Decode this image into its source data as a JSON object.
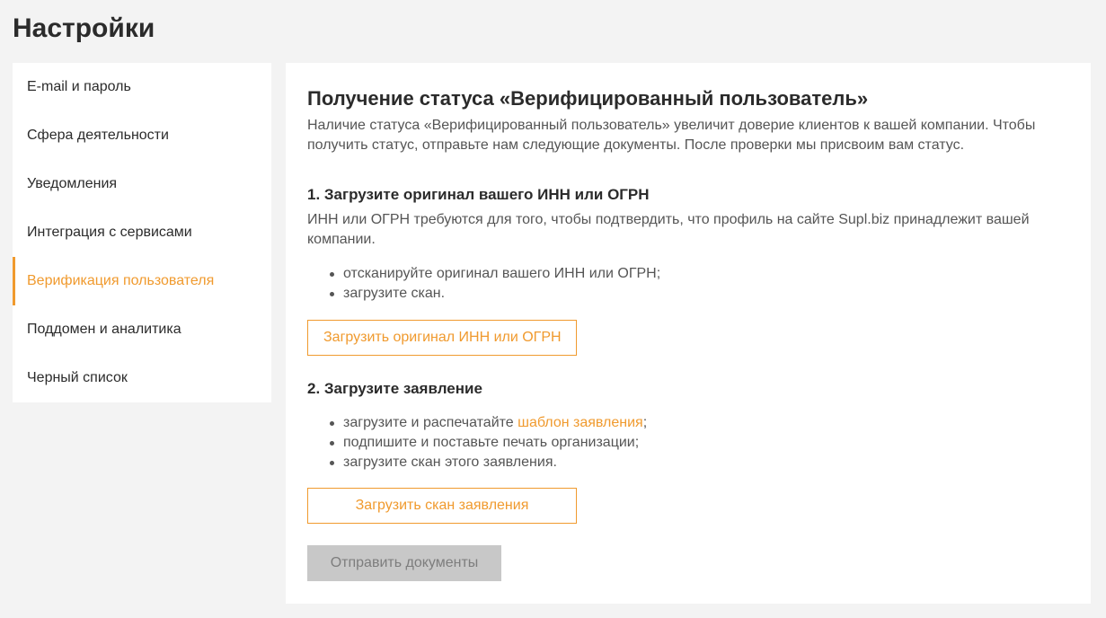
{
  "page": {
    "title": "Настройки"
  },
  "sidebar": {
    "active_index": 4,
    "items": [
      {
        "label": "E-mail и пароль"
      },
      {
        "label": "Сфера деятельности"
      },
      {
        "label": "Уведомления"
      },
      {
        "label": "Интеграция с сервисами"
      },
      {
        "label": "Верификация пользователя"
      },
      {
        "label": "Поддомен и аналитика"
      },
      {
        "label": "Черный список"
      }
    ]
  },
  "main": {
    "title": "Получение статуса «Верифицированный пользователь»",
    "intro": "Наличие статуса «Верифицированный пользователь» увеличит доверие клиентов к вашей компании. Чтобы получить статус, отправьте нам следующие документы. После проверки мы присвоим вам статус.",
    "step1": {
      "title": "1. Загрузите оригинал вашего ИНН или ОГРН",
      "description": "ИНН или ОГРН требуются для того, чтобы подтвердить, что профиль на сайте Supl.biz принадлежит вашей компании.",
      "bullets": [
        "отсканируйте оригинал вашего ИНН или ОГРН;",
        "загрузите скан."
      ],
      "button_label": "Загрузить оригинал ИНН или ОГРН"
    },
    "step2": {
      "title": "2. Загрузите заявление",
      "bullet1_prefix": "загрузите и распечатайте ",
      "bullet1_link": "шаблон заявления",
      "bullet1_suffix": ";",
      "bullets": [
        "подпишите и поставьте печать организации;",
        "загрузите скан этого заявления."
      ],
      "button_label": "Загрузить скан заявления"
    },
    "submit_label": "Отправить документы",
    "submit_disabled": true
  },
  "colors": {
    "accent": "#f09a2e",
    "background": "#f3f3f3",
    "panel": "#ffffff",
    "text": "#2b2b2b",
    "muted_text": "#555555",
    "disabled_button": "#c8c8c8",
    "disabled_button_text": "#7d7d7d"
  }
}
